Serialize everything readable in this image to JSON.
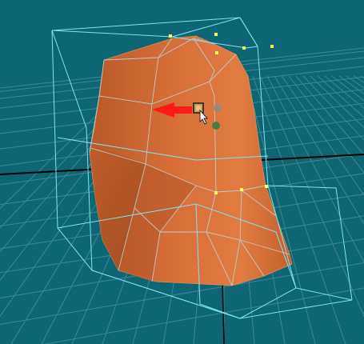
{
  "viewport": {
    "background_color": "#0e6574",
    "grid_color": "#3f8894",
    "axis_color": "#000000",
    "mesh_fill_color": "#d1672f",
    "mesh_shadow_color": "#a24e22",
    "wireframe_color": "#b8d9e3",
    "bounding_box_color": "#7fe4f5",
    "vertex_color": "#ffff55",
    "arrow_color": "#ff1a1a"
  },
  "icons": {
    "manipulator": "selection-square-icon",
    "cursor": "arrow-pointer-icon",
    "pointer": "red-arrow-icon"
  }
}
